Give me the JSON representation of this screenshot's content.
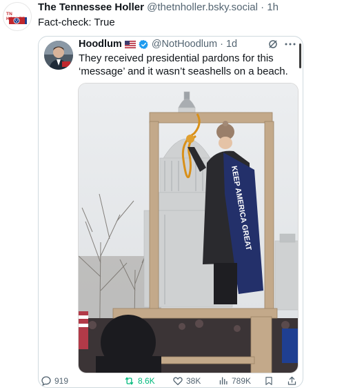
{
  "post": {
    "logo_text": "TN HOLLER",
    "author_name": "The Tennessee Holler",
    "handle": "@thetnholler.bsky.social",
    "time": "1h",
    "separator": "·",
    "text": "Fact-check: True"
  },
  "quoted": {
    "author_name": "Hoodlum",
    "handle": "@NotHoodlum",
    "time": "1d",
    "separator": "·",
    "text": "They received presidential pardons for this ‘message’ and it wasn’t seashells on a beach.",
    "photo_text": "KEEP AMERICA GREAT",
    "more_icon": "ellipsis-icon",
    "grok_icon": "grok-icon"
  },
  "metrics": {
    "replies": "919",
    "reposts": "8.6K",
    "likes": "38K",
    "views": "789K"
  },
  "colors": {
    "repost_green": "#00ba7c",
    "verified_blue": "#1d9bf0",
    "secondary_text": "#536471",
    "tn_red": "#c0272d"
  }
}
